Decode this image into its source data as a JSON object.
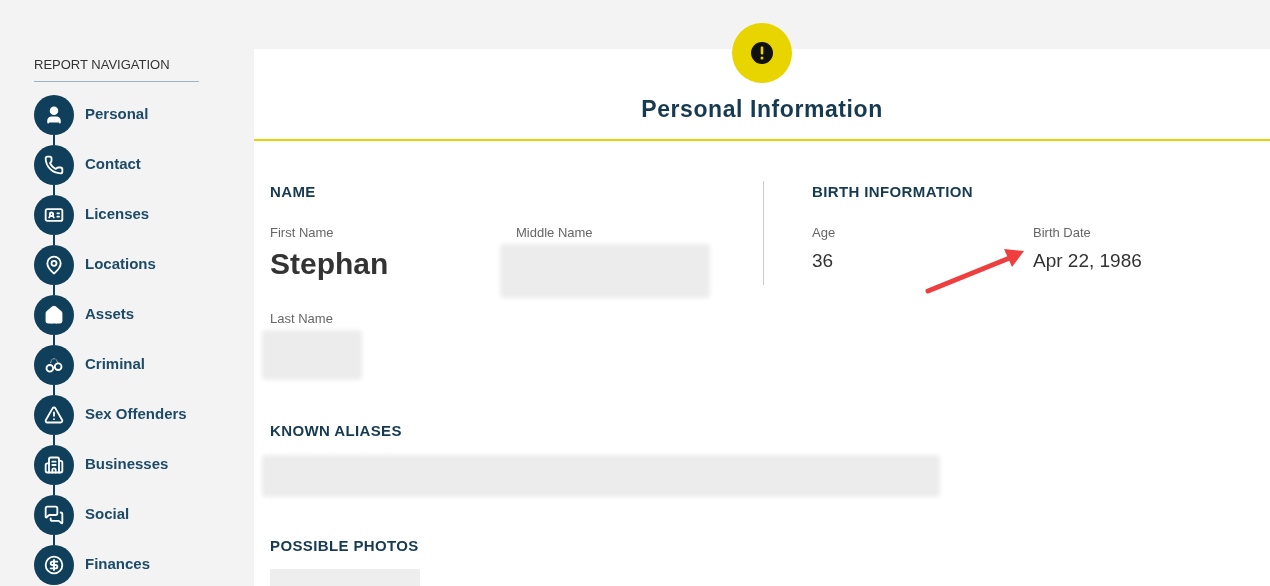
{
  "sidebar": {
    "title": "REPORT NAVIGATION",
    "items": [
      {
        "label": "Personal"
      },
      {
        "label": "Contact"
      },
      {
        "label": "Licenses"
      },
      {
        "label": "Locations"
      },
      {
        "label": "Assets"
      },
      {
        "label": "Criminal"
      },
      {
        "label": "Sex Offenders"
      },
      {
        "label": "Businesses"
      },
      {
        "label": "Social"
      },
      {
        "label": "Finances"
      }
    ]
  },
  "section": {
    "title": "Personal Information",
    "name": {
      "heading": "NAME",
      "first_name_label": "First Name",
      "first_name": "Stephan",
      "middle_name_label": "Middle Name",
      "last_name_label": "Last Name"
    },
    "birth": {
      "heading": "BIRTH INFORMATION",
      "age_label": "Age",
      "age": "36",
      "birth_date_label": "Birth Date",
      "birth_date": "Apr 22, 1986"
    },
    "aliases": {
      "heading": "KNOWN ALIASES"
    },
    "photos": {
      "heading": "POSSIBLE PHOTOS"
    }
  }
}
